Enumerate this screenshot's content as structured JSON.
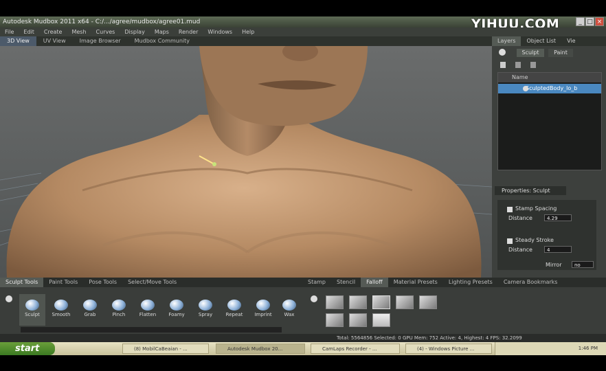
{
  "window": {
    "title": "Autodesk Mudbox 2011 x64 - C:/.../agree/mudbox/agree01.mud",
    "watermark": "YIHUU.COM"
  },
  "menu": [
    "File",
    "Edit",
    "Create",
    "Mesh",
    "Curves",
    "Display",
    "Maps",
    "Render",
    "Windows",
    "Help"
  ],
  "view_tabs": [
    {
      "label": "3D View",
      "active": true
    },
    {
      "label": "UV View",
      "active": false
    },
    {
      "label": "Image Browser",
      "active": false
    },
    {
      "label": "Mudbox Community",
      "active": false
    }
  ],
  "right_panel": {
    "tabs": [
      "Layers",
      "Object List",
      "Vie"
    ],
    "subtabs": [
      "Sculpt",
      "Paint"
    ],
    "list_header": "Name",
    "layer_name": "SculptedBody_lo_b",
    "properties_header": "Properties: Sculpt",
    "props": {
      "stamp_spacing_label": "Stamp Spacing",
      "distance_label": "Distance",
      "distance_value": "4.29",
      "steady_stroke_label": "Steady Stroke",
      "steady_distance_label": "Distance",
      "steady_distance_value": "4",
      "mirror_label": "Mirror",
      "mirror_value": "no"
    }
  },
  "bottom": {
    "tool_tabs": [
      {
        "label": "Sculpt Tools",
        "active": true
      },
      {
        "label": "Paint Tools",
        "active": false
      },
      {
        "label": "Pose Tools",
        "active": false
      },
      {
        "label": "Select/Move Tools",
        "active": false
      }
    ],
    "tools": [
      "Sculpt",
      "Smooth",
      "Grab",
      "Pinch",
      "Flatten",
      "Foamy",
      "Spray",
      "Repeat",
      "Imprint",
      "Wax"
    ],
    "stamp_tabs": [
      {
        "label": "Stamp",
        "active": false
      },
      {
        "label": "Stencil",
        "active": false
      },
      {
        "label": "Falloff",
        "active": true
      },
      {
        "label": "Material Presets",
        "active": false
      },
      {
        "label": "Lighting Presets",
        "active": false
      },
      {
        "label": "Camera Bookmarks",
        "active": false
      }
    ],
    "status": "Total: 5564856  Selected: 0  GPU Mem: 752  Active: 4, Highest: 4  FPS: 32.2099"
  },
  "taskbar": {
    "start": "start",
    "items": [
      {
        "label": "(8) MobilCaBeaian - ...",
        "active": false
      },
      {
        "label": "Autodesk Mudbox 20...",
        "active": true
      },
      {
        "label": "CamLaps Recorder - ...",
        "active": false
      },
      {
        "label": "(4) - Windows Picture ...",
        "active": false
      }
    ],
    "clock": "1:46 PM"
  },
  "colors": {
    "accent": "#4a88c0",
    "skin": "#b58a63"
  }
}
